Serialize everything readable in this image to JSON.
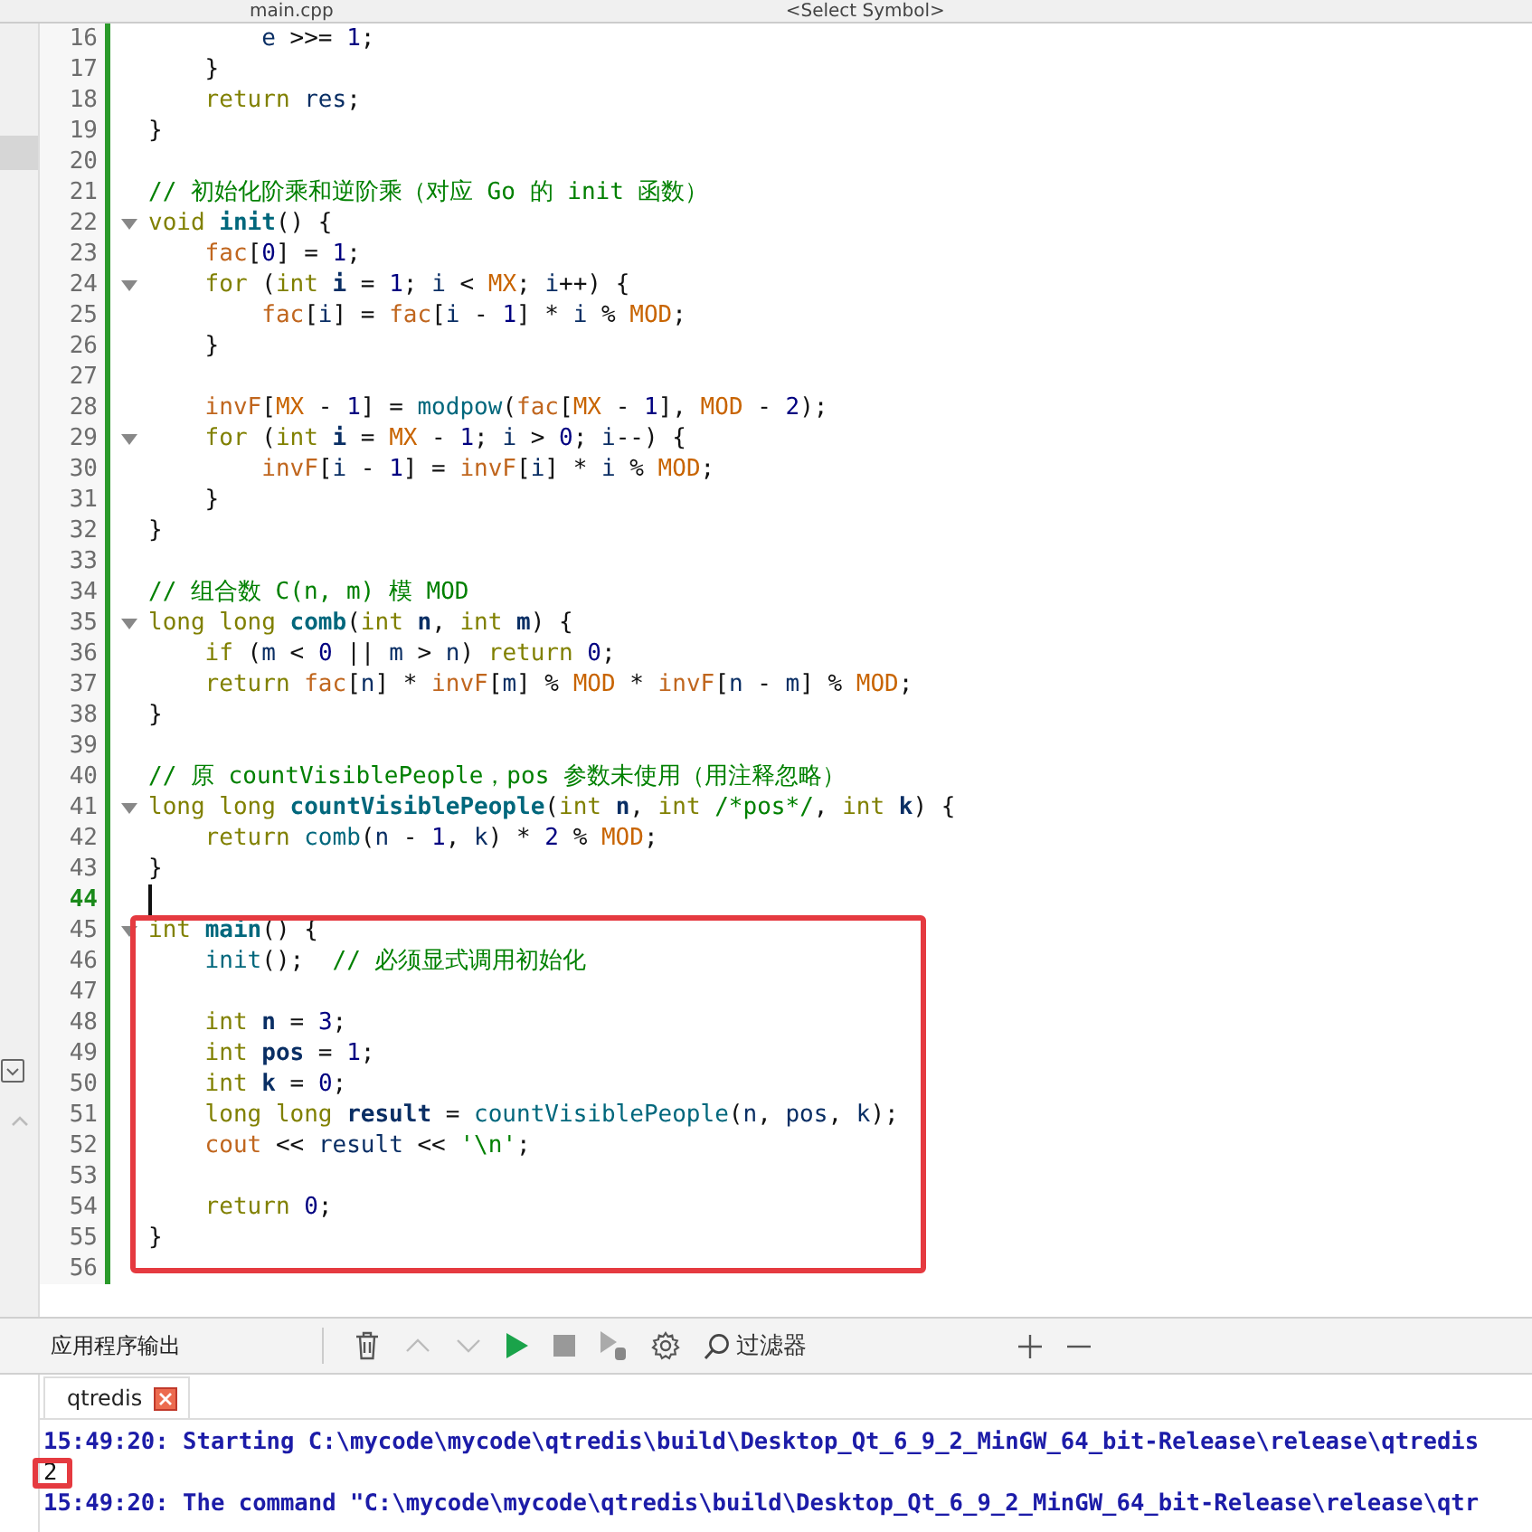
{
  "editor_toolbar": {
    "file": "main.cpp",
    "symbol": "<Select Symbol>"
  },
  "code_lines": [
    {
      "number": "16",
      "fold": false,
      "current": false,
      "tokens": [
        {
          "kind": "var",
          "text": "        e"
        },
        {
          "kind": "p",
          "text": " >>= "
        },
        {
          "kind": "num",
          "text": "1"
        },
        {
          "kind": "p",
          "text": ";"
        }
      ]
    },
    {
      "number": "17",
      "fold": false,
      "current": false,
      "tokens": [
        {
          "kind": "p",
          "text": "    }"
        }
      ]
    },
    {
      "number": "18",
      "fold": false,
      "current": false,
      "tokens": [
        {
          "kind": "kw",
          "text": "    return "
        },
        {
          "kind": "var",
          "text": "res"
        },
        {
          "kind": "p",
          "text": ";"
        }
      ]
    },
    {
      "number": "19",
      "fold": false,
      "current": false,
      "tokens": [
        {
          "kind": "p",
          "text": "}"
        }
      ]
    },
    {
      "number": "20",
      "fold": false,
      "current": false
    },
    {
      "number": "21",
      "fold": false,
      "current": false,
      "tokens": [
        {
          "kind": "comment",
          "text": "// 初始化阶乘和逆阶乘（对应 Go 的 init 函数）"
        }
      ]
    },
    {
      "number": "22",
      "fold": true,
      "current": false,
      "tokens": [
        {
          "kind": "kw",
          "text": "void "
        },
        {
          "kind": "decl",
          "text": "init"
        },
        {
          "kind": "p",
          "text": "() {"
        }
      ]
    },
    {
      "number": "23",
      "fold": false,
      "current": false,
      "tokens": [
        {
          "kind": "global",
          "text": "    fac"
        },
        {
          "kind": "p",
          "text": "["
        },
        {
          "kind": "num",
          "text": "0"
        },
        {
          "kind": "p",
          "text": "] = "
        },
        {
          "kind": "num",
          "text": "1"
        },
        {
          "kind": "p",
          "text": ";"
        }
      ]
    },
    {
      "number": "24",
      "fold": true,
      "current": false,
      "tokens": [
        {
          "kind": "kw",
          "text": "    for"
        },
        {
          "kind": "p",
          "text": " ("
        },
        {
          "kind": "kw",
          "text": "int "
        },
        {
          "kind": "local",
          "text": "i"
        },
        {
          "kind": "p",
          "text": " = "
        },
        {
          "kind": "num",
          "text": "1"
        },
        {
          "kind": "p",
          "text": "; "
        },
        {
          "kind": "var",
          "text": "i"
        },
        {
          "kind": "p",
          "text": " < "
        },
        {
          "kind": "macro",
          "text": "MX"
        },
        {
          "kind": "p",
          "text": "; "
        },
        {
          "kind": "var",
          "text": "i"
        },
        {
          "kind": "p",
          "text": "++) {"
        }
      ]
    },
    {
      "number": "25",
      "fold": false,
      "current": false,
      "tokens": [
        {
          "kind": "global",
          "text": "        fac"
        },
        {
          "kind": "p",
          "text": "["
        },
        {
          "kind": "var",
          "text": "i"
        },
        {
          "kind": "p",
          "text": "] = "
        },
        {
          "kind": "global",
          "text": "fac"
        },
        {
          "kind": "p",
          "text": "["
        },
        {
          "kind": "var",
          "text": "i"
        },
        {
          "kind": "p",
          "text": " - "
        },
        {
          "kind": "num",
          "text": "1"
        },
        {
          "kind": "p",
          "text": "] * "
        },
        {
          "kind": "var",
          "text": "i"
        },
        {
          "kind": "p",
          "text": " % "
        },
        {
          "kind": "macro",
          "text": "MOD"
        },
        {
          "kind": "p",
          "text": ";"
        }
      ]
    },
    {
      "number": "26",
      "fold": false,
      "current": false,
      "tokens": [
        {
          "kind": "p",
          "text": "    }"
        }
      ]
    },
    {
      "number": "27",
      "fold": false,
      "current": false
    },
    {
      "number": "28",
      "fold": false,
      "current": false,
      "tokens": [
        {
          "kind": "global",
          "text": "    invF"
        },
        {
          "kind": "p",
          "text": "["
        },
        {
          "kind": "macro",
          "text": "MX"
        },
        {
          "kind": "p",
          "text": " - "
        },
        {
          "kind": "num",
          "text": "1"
        },
        {
          "kind": "p",
          "text": "] = "
        },
        {
          "kind": "fn",
          "text": "modpow"
        },
        {
          "kind": "p",
          "text": "("
        },
        {
          "kind": "global",
          "text": "fac"
        },
        {
          "kind": "p",
          "text": "["
        },
        {
          "kind": "macro",
          "text": "MX"
        },
        {
          "kind": "p",
          "text": " - "
        },
        {
          "kind": "num",
          "text": "1"
        },
        {
          "kind": "p",
          "text": "], "
        },
        {
          "kind": "macro",
          "text": "MOD"
        },
        {
          "kind": "p",
          "text": " - "
        },
        {
          "kind": "num",
          "text": "2"
        },
        {
          "kind": "p",
          "text": ");"
        }
      ]
    },
    {
      "number": "29",
      "fold": true,
      "current": false,
      "tokens": [
        {
          "kind": "kw",
          "text": "    for"
        },
        {
          "kind": "p",
          "text": " ("
        },
        {
          "kind": "kw",
          "text": "int "
        },
        {
          "kind": "local",
          "text": "i"
        },
        {
          "kind": "p",
          "text": " = "
        },
        {
          "kind": "macro",
          "text": "MX"
        },
        {
          "kind": "p",
          "text": " - "
        },
        {
          "kind": "num",
          "text": "1"
        },
        {
          "kind": "p",
          "text": "; "
        },
        {
          "kind": "var",
          "text": "i"
        },
        {
          "kind": "p",
          "text": " > "
        },
        {
          "kind": "num",
          "text": "0"
        },
        {
          "kind": "p",
          "text": "; "
        },
        {
          "kind": "var",
          "text": "i"
        },
        {
          "kind": "p",
          "text": "--) {"
        }
      ]
    },
    {
      "number": "30",
      "fold": false,
      "current": false,
      "tokens": [
        {
          "kind": "global",
          "text": "        invF"
        },
        {
          "kind": "p",
          "text": "["
        },
        {
          "kind": "var",
          "text": "i"
        },
        {
          "kind": "p",
          "text": " - "
        },
        {
          "kind": "num",
          "text": "1"
        },
        {
          "kind": "p",
          "text": "] = "
        },
        {
          "kind": "global",
          "text": "invF"
        },
        {
          "kind": "p",
          "text": "["
        },
        {
          "kind": "var",
          "text": "i"
        },
        {
          "kind": "p",
          "text": "] * "
        },
        {
          "kind": "var",
          "text": "i"
        },
        {
          "kind": "p",
          "text": " % "
        },
        {
          "kind": "macro",
          "text": "MOD"
        },
        {
          "kind": "p",
          "text": ";"
        }
      ]
    },
    {
      "number": "31",
      "fold": false,
      "current": false,
      "tokens": [
        {
          "kind": "p",
          "text": "    }"
        }
      ]
    },
    {
      "number": "32",
      "fold": false,
      "current": false,
      "tokens": [
        {
          "kind": "p",
          "text": "}"
        }
      ]
    },
    {
      "number": "33",
      "fold": false,
      "current": false
    },
    {
      "number": "34",
      "fold": false,
      "current": false,
      "tokens": [
        {
          "kind": "comment",
          "text": "// 组合数 C(n, m) 模 MOD"
        }
      ]
    },
    {
      "number": "35",
      "fold": true,
      "current": false,
      "tokens": [
        {
          "kind": "kw",
          "text": "long long "
        },
        {
          "kind": "decl",
          "text": "comb"
        },
        {
          "kind": "p",
          "text": "("
        },
        {
          "kind": "kw",
          "text": "int "
        },
        {
          "kind": "local",
          "text": "n"
        },
        {
          "kind": "p",
          "text": ", "
        },
        {
          "kind": "kw",
          "text": "int "
        },
        {
          "kind": "local",
          "text": "m"
        },
        {
          "kind": "p",
          "text": ") {"
        }
      ]
    },
    {
      "number": "36",
      "fold": false,
      "current": false,
      "tokens": [
        {
          "kind": "kw",
          "text": "    if"
        },
        {
          "kind": "p",
          "text": " ("
        },
        {
          "kind": "var",
          "text": "m"
        },
        {
          "kind": "p",
          "text": " < "
        },
        {
          "kind": "num",
          "text": "0"
        },
        {
          "kind": "p",
          "text": " || "
        },
        {
          "kind": "var",
          "text": "m"
        },
        {
          "kind": "p",
          "text": " > "
        },
        {
          "kind": "var",
          "text": "n"
        },
        {
          "kind": "p",
          "text": ") "
        },
        {
          "kind": "kw",
          "text": "return "
        },
        {
          "kind": "num",
          "text": "0"
        },
        {
          "kind": "p",
          "text": ";"
        }
      ]
    },
    {
      "number": "37",
      "fold": false,
      "current": false,
      "tokens": [
        {
          "kind": "kw",
          "text": "    return "
        },
        {
          "kind": "global",
          "text": "fac"
        },
        {
          "kind": "p",
          "text": "["
        },
        {
          "kind": "var",
          "text": "n"
        },
        {
          "kind": "p",
          "text": "] * "
        },
        {
          "kind": "global",
          "text": "invF"
        },
        {
          "kind": "p",
          "text": "["
        },
        {
          "kind": "var",
          "text": "m"
        },
        {
          "kind": "p",
          "text": "] % "
        },
        {
          "kind": "macro",
          "text": "MOD"
        },
        {
          "kind": "p",
          "text": " * "
        },
        {
          "kind": "global",
          "text": "invF"
        },
        {
          "kind": "p",
          "text": "["
        },
        {
          "kind": "var",
          "text": "n"
        },
        {
          "kind": "p",
          "text": " - "
        },
        {
          "kind": "var",
          "text": "m"
        },
        {
          "kind": "p",
          "text": "] % "
        },
        {
          "kind": "macro",
          "text": "MOD"
        },
        {
          "kind": "p",
          "text": ";"
        }
      ]
    },
    {
      "number": "38",
      "fold": false,
      "current": false,
      "tokens": [
        {
          "kind": "p",
          "text": "}"
        }
      ]
    },
    {
      "number": "39",
      "fold": false,
      "current": false
    },
    {
      "number": "40",
      "fold": false,
      "current": false,
      "tokens": [
        {
          "kind": "comment",
          "text": "// 原 countVisiblePeople，pos 参数未使用（用注释忽略）"
        }
      ]
    },
    {
      "number": "41",
      "fold": true,
      "current": false,
      "tokens": [
        {
          "kind": "kw",
          "text": "long long "
        },
        {
          "kind": "decl",
          "text": "countVisiblePeople"
        },
        {
          "kind": "p",
          "text": "("
        },
        {
          "kind": "kw",
          "text": "int "
        },
        {
          "kind": "local",
          "text": "n"
        },
        {
          "kind": "p",
          "text": ", "
        },
        {
          "kind": "kw",
          "text": "int "
        },
        {
          "kind": "comment",
          "text": "/*pos*/"
        },
        {
          "kind": "p",
          "text": ", "
        },
        {
          "kind": "kw",
          "text": "int "
        },
        {
          "kind": "local",
          "text": "k"
        },
        {
          "kind": "p",
          "text": ") {"
        }
      ]
    },
    {
      "number": "42",
      "fold": false,
      "current": false,
      "tokens": [
        {
          "kind": "kw",
          "text": "    return "
        },
        {
          "kind": "fn",
          "text": "comb"
        },
        {
          "kind": "p",
          "text": "("
        },
        {
          "kind": "var",
          "text": "n"
        },
        {
          "kind": "p",
          "text": " - "
        },
        {
          "kind": "num",
          "text": "1"
        },
        {
          "kind": "p",
          "text": ", "
        },
        {
          "kind": "var",
          "text": "k"
        },
        {
          "kind": "p",
          "text": ") * "
        },
        {
          "kind": "num",
          "text": "2"
        },
        {
          "kind": "p",
          "text": " % "
        },
        {
          "kind": "macro",
          "text": "MOD"
        },
        {
          "kind": "p",
          "text": ";"
        }
      ]
    },
    {
      "number": "43",
      "fold": false,
      "current": false,
      "tokens": [
        {
          "kind": "p",
          "text": "}"
        }
      ]
    },
    {
      "number": "44",
      "fold": false,
      "current": true
    },
    {
      "number": "45",
      "fold": true,
      "current": false,
      "tokens": [
        {
          "kind": "kw",
          "text": "int "
        },
        {
          "kind": "decl",
          "text": "main"
        },
        {
          "kind": "p",
          "text": "() {"
        }
      ]
    },
    {
      "number": "46",
      "fold": false,
      "current": false,
      "tokens": [
        {
          "kind": "fn",
          "text": "    init"
        },
        {
          "kind": "p",
          "text": "();  "
        },
        {
          "kind": "comment",
          "text": "// 必须显式调用初始化"
        }
      ]
    },
    {
      "number": "47",
      "fold": false,
      "current": false
    },
    {
      "number": "48",
      "fold": false,
      "current": false,
      "tokens": [
        {
          "kind": "kw",
          "text": "    int "
        },
        {
          "kind": "local",
          "text": "n"
        },
        {
          "kind": "p",
          "text": " = "
        },
        {
          "kind": "num",
          "text": "3"
        },
        {
          "kind": "p",
          "text": ";"
        }
      ]
    },
    {
      "number": "49",
      "fold": false,
      "current": false,
      "tokens": [
        {
          "kind": "kw",
          "text": "    int "
        },
        {
          "kind": "local",
          "text": "pos"
        },
        {
          "kind": "p",
          "text": " = "
        },
        {
          "kind": "num",
          "text": "1"
        },
        {
          "kind": "p",
          "text": ";"
        }
      ]
    },
    {
      "number": "50",
      "fold": false,
      "current": false,
      "tokens": [
        {
          "kind": "kw",
          "text": "    int "
        },
        {
          "kind": "local",
          "text": "k"
        },
        {
          "kind": "p",
          "text": " = "
        },
        {
          "kind": "num",
          "text": "0"
        },
        {
          "kind": "p",
          "text": ";"
        }
      ]
    },
    {
      "number": "51",
      "fold": false,
      "current": false,
      "tokens": [
        {
          "kind": "kw",
          "text": "    long long "
        },
        {
          "kind": "local",
          "text": "result"
        },
        {
          "kind": "p",
          "text": " = "
        },
        {
          "kind": "fn",
          "text": "countVisiblePeople"
        },
        {
          "kind": "p",
          "text": "("
        },
        {
          "kind": "var",
          "text": "n"
        },
        {
          "kind": "p",
          "text": ", "
        },
        {
          "kind": "var",
          "text": "pos"
        },
        {
          "kind": "p",
          "text": ", "
        },
        {
          "kind": "var",
          "text": "k"
        },
        {
          "kind": "p",
          "text": ");"
        }
      ]
    },
    {
      "number": "52",
      "fold": false,
      "current": false,
      "tokens": [
        {
          "kind": "global",
          "text": "    cout"
        },
        {
          "kind": "p",
          "text": " << "
        },
        {
          "kind": "var",
          "text": "result"
        },
        {
          "kind": "p",
          "text": " << "
        },
        {
          "kind": "str",
          "text": "'\\n'"
        },
        {
          "kind": "p",
          "text": ";"
        }
      ]
    },
    {
      "number": "53",
      "fold": false,
      "current": false
    },
    {
      "number": "54",
      "fold": false,
      "current": false,
      "tokens": [
        {
          "kind": "kw",
          "text": "    return "
        },
        {
          "kind": "num",
          "text": "0"
        },
        {
          "kind": "p",
          "text": ";"
        }
      ]
    },
    {
      "number": "55",
      "fold": false,
      "current": false,
      "tokens": [
        {
          "kind": "p",
          "text": "}"
        }
      ]
    },
    {
      "number": "56",
      "fold": false,
      "current": false
    }
  ],
  "output_panel": {
    "title": "应用程序输出",
    "filter_placeholder": "过滤器",
    "tab": {
      "label": "qtredis"
    },
    "lines": [
      {
        "kind": "info",
        "text": "15:49:20: Starting C:\\mycode\\mycode\\qtredis\\build\\Desktop_Qt_6_9_2_MinGW_64_bit-Release\\release\\qtredis"
      },
      {
        "kind": "stdout",
        "text": "2"
      },
      {
        "kind": "info",
        "text": "15:49:20: The command \"C:\\mycode\\mycode\\qtredis\\build\\Desktop_Qt_6_9_2_MinGW_64_bit-Release\\release\\qtr"
      }
    ]
  }
}
